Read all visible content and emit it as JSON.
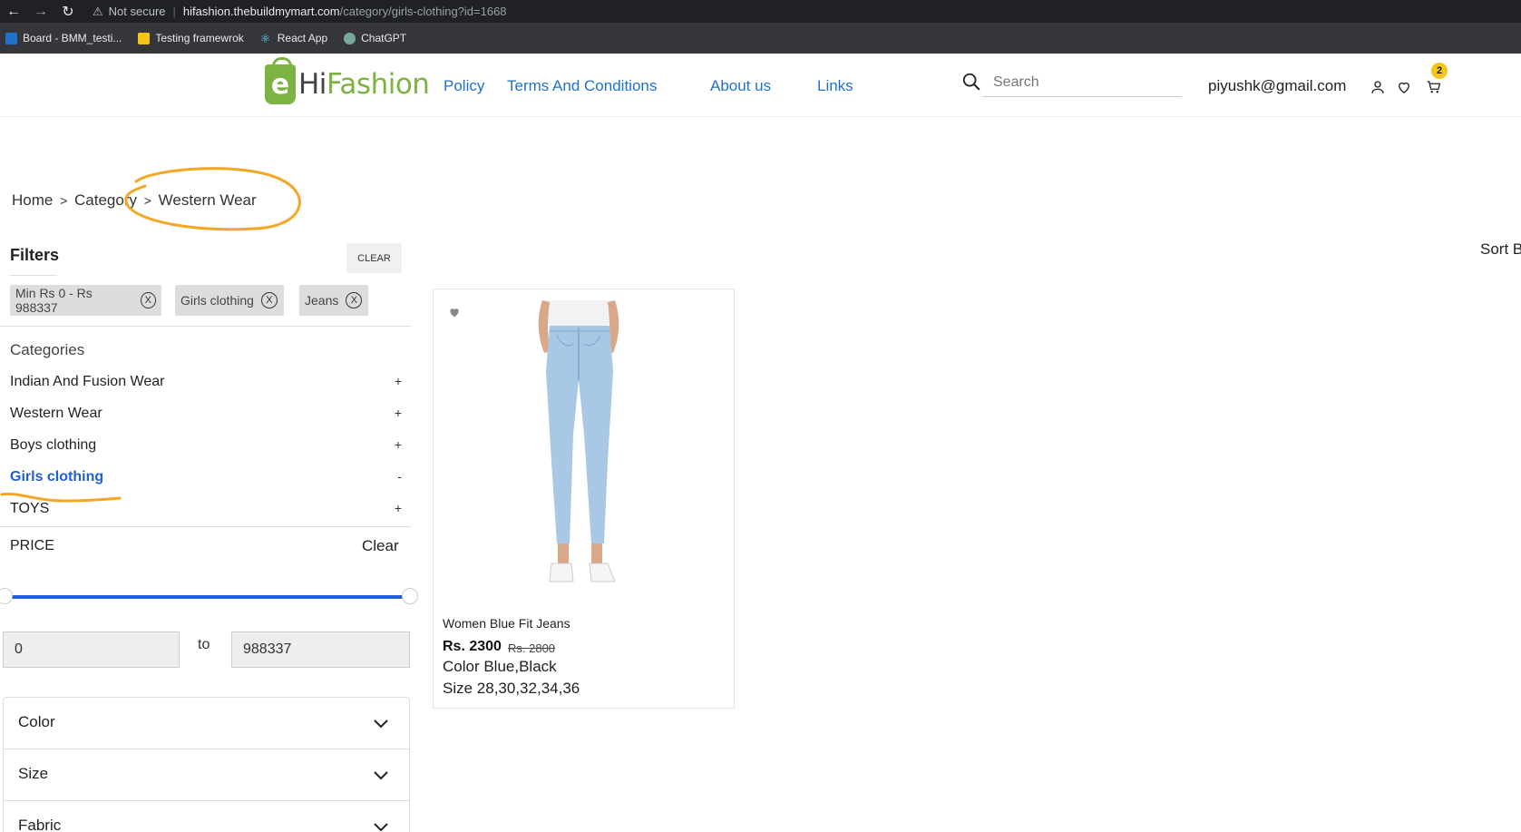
{
  "browser": {
    "security_label": "Not secure",
    "url_host": "hifashion.thebuildmymart.com",
    "url_path": "/category/girls-clothing?id=1668",
    "bookmarks": [
      {
        "label": "Board - BMM_testi...",
        "color": "#1f72c9"
      },
      {
        "label": "Testing framewrok",
        "color": "#f5c518"
      },
      {
        "label": "React App",
        "color": "#61dafb"
      },
      {
        "label": "ChatGPT",
        "color": "#74aa9c"
      }
    ]
  },
  "header": {
    "logo_letter": "e",
    "logo_hi": "Hi",
    "logo_fashion": "Fashion",
    "nav": [
      "Policy",
      "Terms And Conditions",
      "About us",
      "Links"
    ],
    "search_placeholder": "Search",
    "email": "piyushk@gmail.com",
    "cart_count": "2"
  },
  "breadcrumb": {
    "home": "Home",
    "category": "Category",
    "current": "Western Wear",
    "separator": ">"
  },
  "filters": {
    "title": "Filters",
    "clear_label": "CLEAR",
    "chips": [
      "Min Rs 0 - Rs 988337",
      "Girls clothing",
      "Jeans"
    ],
    "chip_remove": "X",
    "categories_title": "Categories",
    "categories": [
      {
        "label": "Indian And Fusion Wear",
        "toggle": "+",
        "active": false
      },
      {
        "label": "Western Wear",
        "toggle": "+",
        "active": false
      },
      {
        "label": "Boys clothing",
        "toggle": "+",
        "active": false
      },
      {
        "label": "Girls clothing",
        "toggle": "-",
        "active": true
      },
      {
        "label": "TOYS",
        "toggle": "+",
        "active": false
      }
    ],
    "price_title": "PRICE",
    "price_clear": "Clear",
    "price_min": "0",
    "price_max": "988337",
    "price_to": "to",
    "accordions": [
      "Color",
      "Size",
      "Fabric"
    ]
  },
  "sort_label": "Sort B",
  "product": {
    "name": "Women Blue Fit Jeans",
    "price": "Rs. 2300",
    "old_price": "Rs. 2800",
    "color": "Color Blue,Black",
    "size": "Size 28,30,32,34,36"
  },
  "colors": {
    "accent": "#1f72c9",
    "brand_green": "#7cb342",
    "annotation": "#f5a623"
  }
}
